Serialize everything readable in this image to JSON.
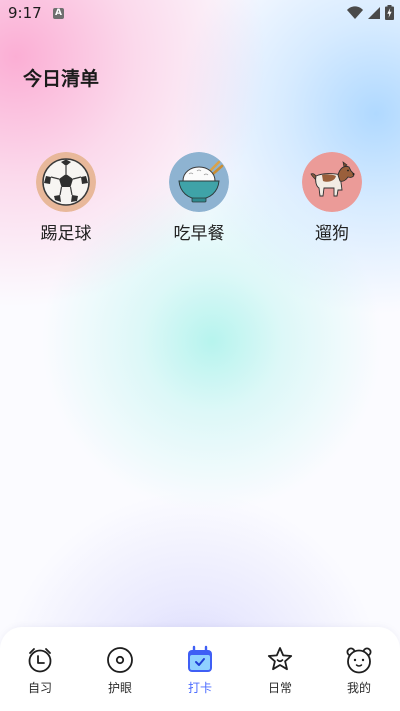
{
  "status_bar": {
    "time": "9:17",
    "notification_letter": "A"
  },
  "header": {
    "title": "今日清单"
  },
  "tasks": [
    {
      "label": "踢足球",
      "icon": "soccer-ball-icon",
      "bg_color": "#e8b89a"
    },
    {
      "label": "吃早餐",
      "icon": "rice-bowl-icon",
      "bg_color": "#8eb3d1"
    },
    {
      "label": "遛狗",
      "icon": "dog-icon",
      "bg_color": "#eb9b98"
    }
  ],
  "bottom_nav": {
    "active_index": 2,
    "active_color": "#4b6bff",
    "items": [
      {
        "label": "自习",
        "icon": "alarm-clock-icon"
      },
      {
        "label": "护眼",
        "icon": "eye-circle-icon"
      },
      {
        "label": "打卡",
        "icon": "calendar-check-icon"
      },
      {
        "label": "日常",
        "icon": "star-icon"
      },
      {
        "label": "我的",
        "icon": "bear-face-icon"
      }
    ]
  }
}
